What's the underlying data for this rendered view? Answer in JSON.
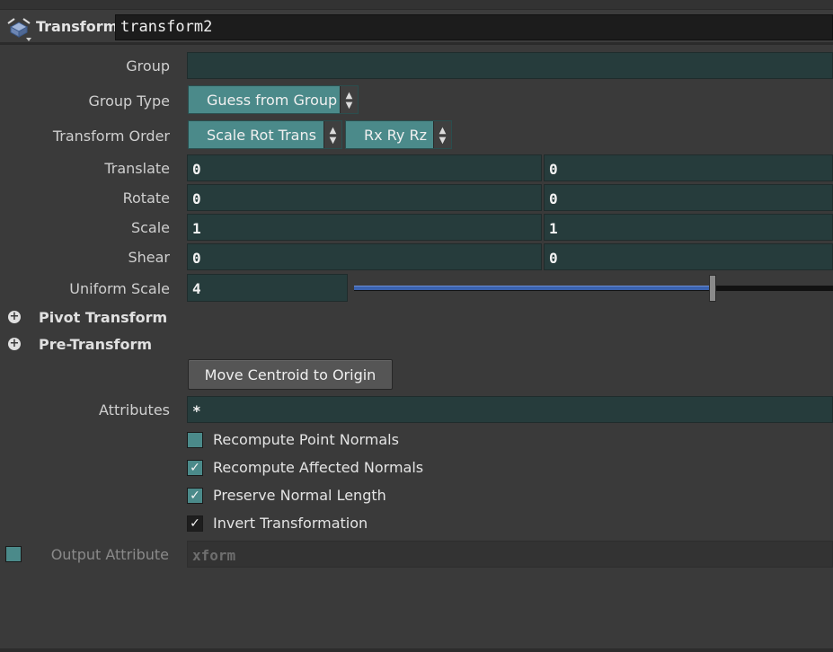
{
  "header": {
    "node_type": "Transform",
    "node_name": "transform2",
    "icon": "transform-node-icon"
  },
  "params": {
    "group": {
      "label": "Group",
      "value": ""
    },
    "group_type": {
      "label": "Group Type",
      "value": "Guess from Group"
    },
    "transform_order": {
      "label": "Transform Order",
      "xform_value": "Scale Rot Trans",
      "rot_value": "Rx Ry Rz"
    },
    "translate": {
      "label": "Translate",
      "x": "0",
      "y": "0"
    },
    "rotate": {
      "label": "Rotate",
      "x": "0",
      "y": "0"
    },
    "scale": {
      "label": "Scale",
      "x": "1",
      "y": "1"
    },
    "shear": {
      "label": "Shear",
      "x": "0",
      "y": "0"
    },
    "uniform_scale": {
      "label": "Uniform Scale",
      "value": "4"
    },
    "pivot_transform": {
      "label": "Pivot Transform"
    },
    "pre_transform": {
      "label": "Pre-Transform"
    },
    "move_centroid": {
      "label": "Move Centroid to Origin"
    },
    "attributes": {
      "label": "Attributes",
      "value": "*"
    },
    "recompute_point_normals": {
      "label": "Recompute Point Normals",
      "checked": false
    },
    "recompute_affected_normals": {
      "label": "Recompute Affected Normals",
      "checked": true,
      "mark": "✓"
    },
    "preserve_normal_length": {
      "label": "Preserve Normal Length",
      "checked": true,
      "mark": "✓"
    },
    "invert_transformation": {
      "label": "Invert Transformation",
      "checked": true,
      "mark": "✓"
    },
    "output_attribute": {
      "label": "Output Attribute",
      "value": "xform",
      "enabled": false
    }
  },
  "colors": {
    "accent_teal": "#4b8a8a",
    "field_bg": "#263c3c",
    "slider_fill": "#3b63b0",
    "panel_bg": "#3a3a3a"
  }
}
